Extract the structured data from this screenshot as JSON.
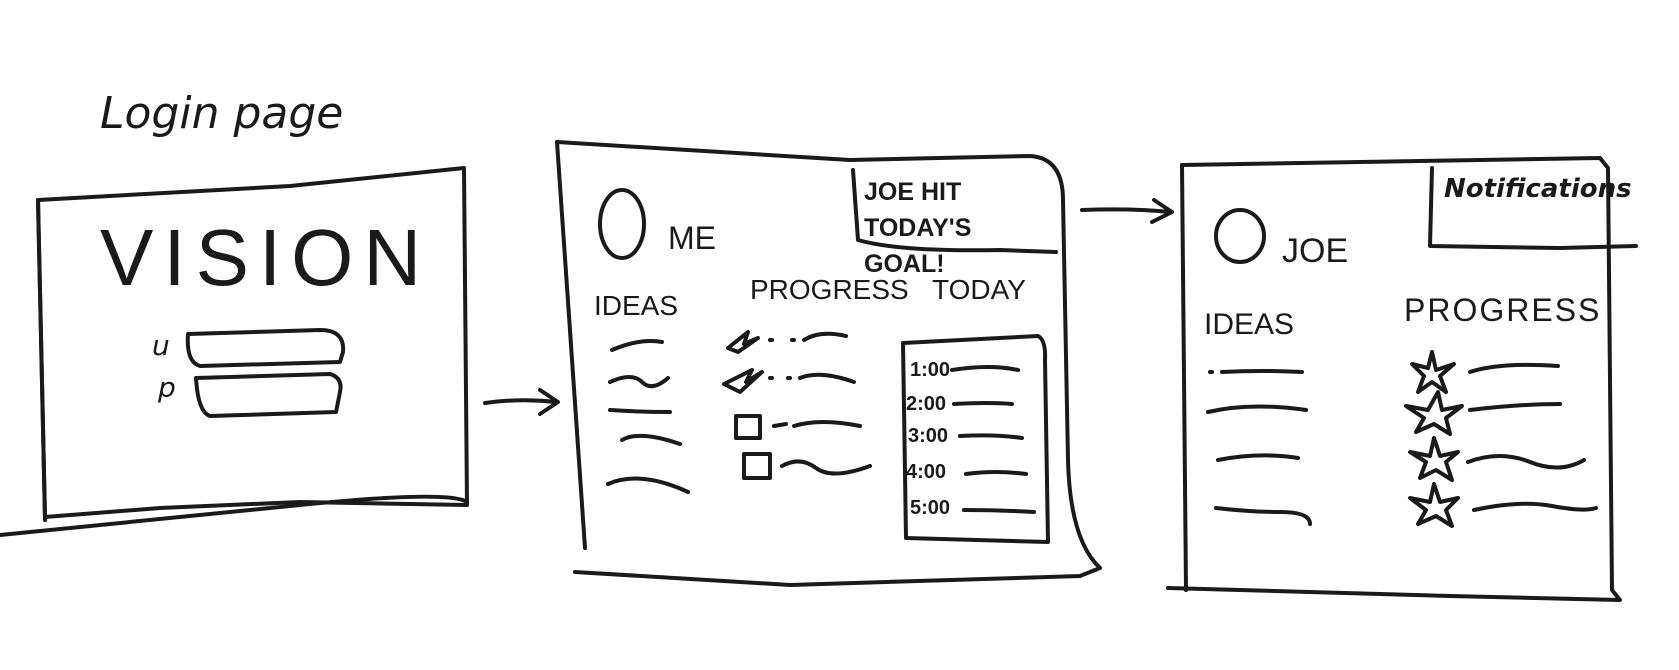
{
  "login": {
    "caption": "Login page",
    "title": "VISION",
    "username_label": "u",
    "password_label": "p"
  },
  "dashboard_me": {
    "user_name": "ME",
    "notice": "JOE HIT TODAY'S GOAL!",
    "ideas_heading": "IDEAS",
    "progress_heading": "PROGRESS",
    "today_heading": "TODAY",
    "schedule_times": [
      "1:00",
      "2:00",
      "3:00",
      "4:00",
      "5:00"
    ]
  },
  "dashboard_joe": {
    "user_name": "JOE",
    "notifications_label": "Notifications",
    "ideas_heading": "IDEAS",
    "progress_heading": "PROGRESS"
  },
  "icons": [
    "arrow-right-icon",
    "avatar-circle-icon",
    "star-icon",
    "checkbox-icon"
  ]
}
